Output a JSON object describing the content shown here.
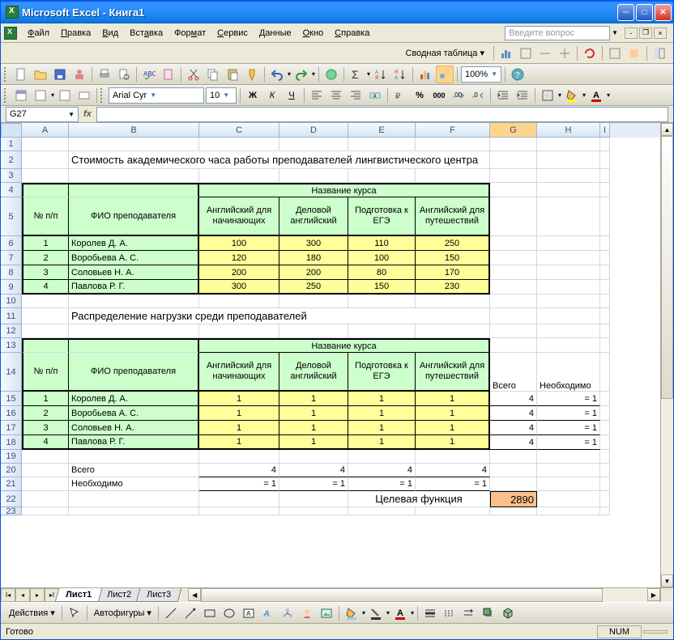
{
  "window": {
    "title": "Microsoft Excel - Книга1"
  },
  "menu": {
    "file": "Файл",
    "edit": "Правка",
    "view": "Вид",
    "insert": "Вставка",
    "format": "Формат",
    "service": "Сервис",
    "data": "Данные",
    "window": "Окно",
    "help": "Справка"
  },
  "ask": {
    "placeholder": "Введите вопрос"
  },
  "pivot": {
    "label": "Сводная таблица"
  },
  "font": {
    "name": "Arial Cyr",
    "size": "10"
  },
  "zoom": "100%",
  "namebox": "G27",
  "columns": [
    "A",
    "B",
    "C",
    "D",
    "E",
    "F",
    "G",
    "H",
    "I"
  ],
  "row2_title": "Стоимость академического часа работы преподавателей лингвистического центра",
  "row4_course_header": "Название курса",
  "row5": {
    "num": "№ п/п",
    "fio": "ФИО преподавателя",
    "c": "Английский для начинающих",
    "d": "Деловой английский",
    "e": "Подготовка к ЕГЭ",
    "f": "Английский для путешествий"
  },
  "t1": [
    {
      "n": "1",
      "fio": "Королев Д. А.",
      "c": "100",
      "d": "300",
      "e": "110",
      "f": "250"
    },
    {
      "n": "2",
      "fio": "Воробьева А. С.",
      "c": "120",
      "d": "180",
      "e": "100",
      "f": "150"
    },
    {
      "n": "3",
      "fio": "Соловьев Н. А.",
      "c": "200",
      "d": "200",
      "e": "80",
      "f": "170"
    },
    {
      "n": "4",
      "fio": "Павлова Р. Г.",
      "c": "300",
      "d": "250",
      "e": "150",
      "f": "230"
    }
  ],
  "row11_title": "Распределение нагрузки среди преподавателей",
  "row14": {
    "g": "Всего",
    "h": "Необходимо"
  },
  "t2": [
    {
      "n": "1",
      "fio": "Королев Д. А.",
      "c": "1",
      "d": "1",
      "e": "1",
      "f": "1",
      "g": "4",
      "h": "= 1"
    },
    {
      "n": "2",
      "fio": "Воробьева А. С.",
      "c": "1",
      "d": "1",
      "e": "1",
      "f": "1",
      "g": "4",
      "h": "= 1"
    },
    {
      "n": "3",
      "fio": "Соловьев Н. А.",
      "c": "1",
      "d": "1",
      "e": "1",
      "f": "1",
      "g": "4",
      "h": "= 1"
    },
    {
      "n": "4",
      "fio": "Павлова Р. Г.",
      "c": "1",
      "d": "1",
      "e": "1",
      "f": "1",
      "g": "4",
      "h": "= 1"
    }
  ],
  "row20": {
    "b": "Всего",
    "c": "4",
    "d": "4",
    "e": "4",
    "f": "4"
  },
  "row21": {
    "b": "Необходимо",
    "c": "= 1",
    "d": "= 1",
    "e": "= 1",
    "f": "= 1"
  },
  "row22": {
    "label": "Целевая функция",
    "value": "2890"
  },
  "tabs": {
    "s1": "Лист1",
    "s2": "Лист2",
    "s3": "Лист3"
  },
  "draw": {
    "actions": "Действия",
    "autoshapes": "Автофигуры"
  },
  "status": {
    "ready": "Готово",
    "num": "NUM"
  }
}
